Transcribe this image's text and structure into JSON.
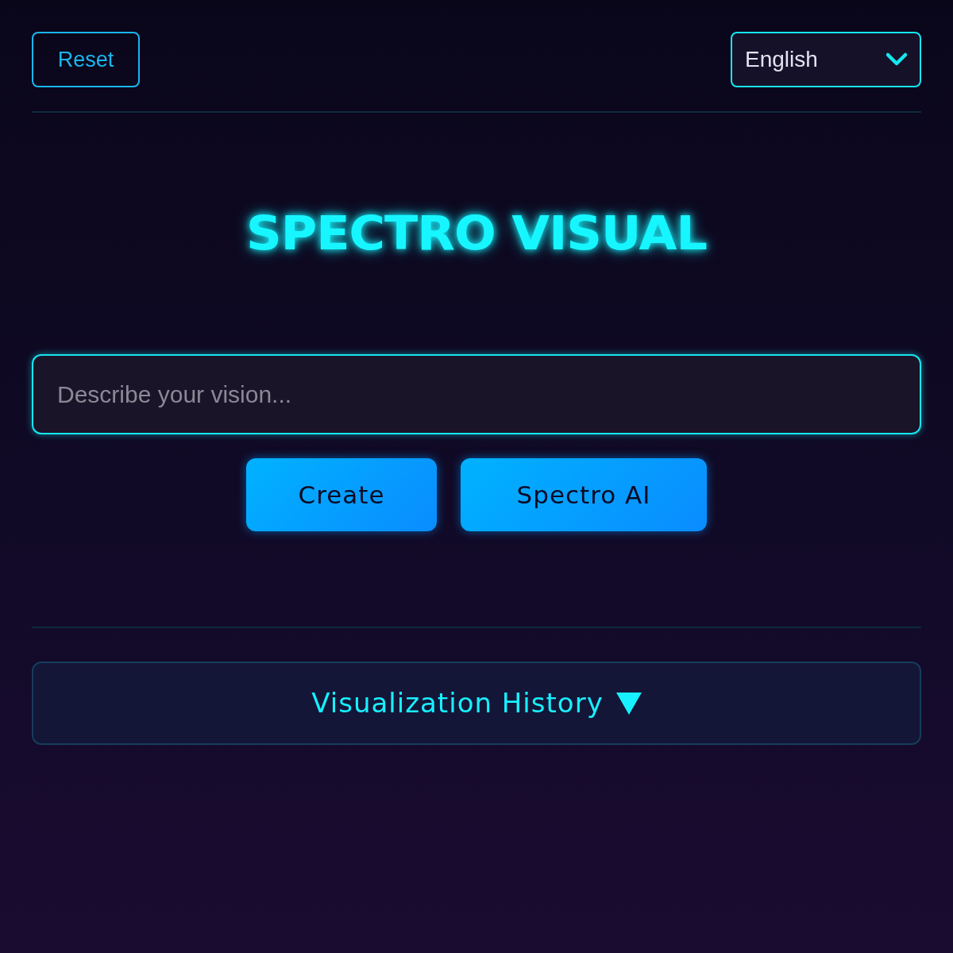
{
  "toolbar": {
    "reset_button": "Reset",
    "language": "English"
  },
  "title": "SPECTRO VISUAL",
  "prompt": {
    "placeholder": "Describe your vision..."
  },
  "actions": [
    "Create",
    "Spectro AI"
  ],
  "history": {
    "label": "Visualization History"
  }
}
